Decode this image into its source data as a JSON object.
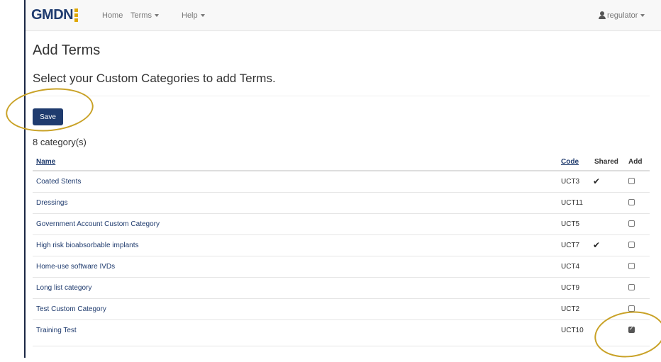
{
  "navbar": {
    "brand": "GMDN",
    "items": [
      "Home",
      "Terms",
      "Help"
    ],
    "user": "regulator"
  },
  "page": {
    "title": "Add Terms",
    "subtitle": "Select your Custom Categories to add Terms.",
    "save_label": "Save",
    "count": "8 category(s)"
  },
  "table": {
    "headers": {
      "name": "Name",
      "code": "Code",
      "shared": "Shared",
      "add": "Add"
    },
    "rows": [
      {
        "name": "Coated Stents",
        "code": "UCT3",
        "shared": true,
        "add": false
      },
      {
        "name": "Dressings",
        "code": "UCT11",
        "shared": false,
        "add": false
      },
      {
        "name": "Government Account Custom Category",
        "code": "UCT5",
        "shared": false,
        "add": false
      },
      {
        "name": "High risk bioabsorbable implants",
        "code": "UCT7",
        "shared": true,
        "add": false
      },
      {
        "name": "Home-use software IVDs",
        "code": "UCT4",
        "shared": false,
        "add": false
      },
      {
        "name": "Long list category",
        "code": "UCT9",
        "shared": false,
        "add": false
      },
      {
        "name": "Test Custom Category",
        "code": "UCT2",
        "shared": false,
        "add": false
      },
      {
        "name": "Training Test",
        "code": "UCT10",
        "shared": false,
        "add": true
      }
    ]
  },
  "colors": {
    "brand": "#1f3b6e",
    "highlight": "#c9a227",
    "accent": "#e0a800"
  }
}
